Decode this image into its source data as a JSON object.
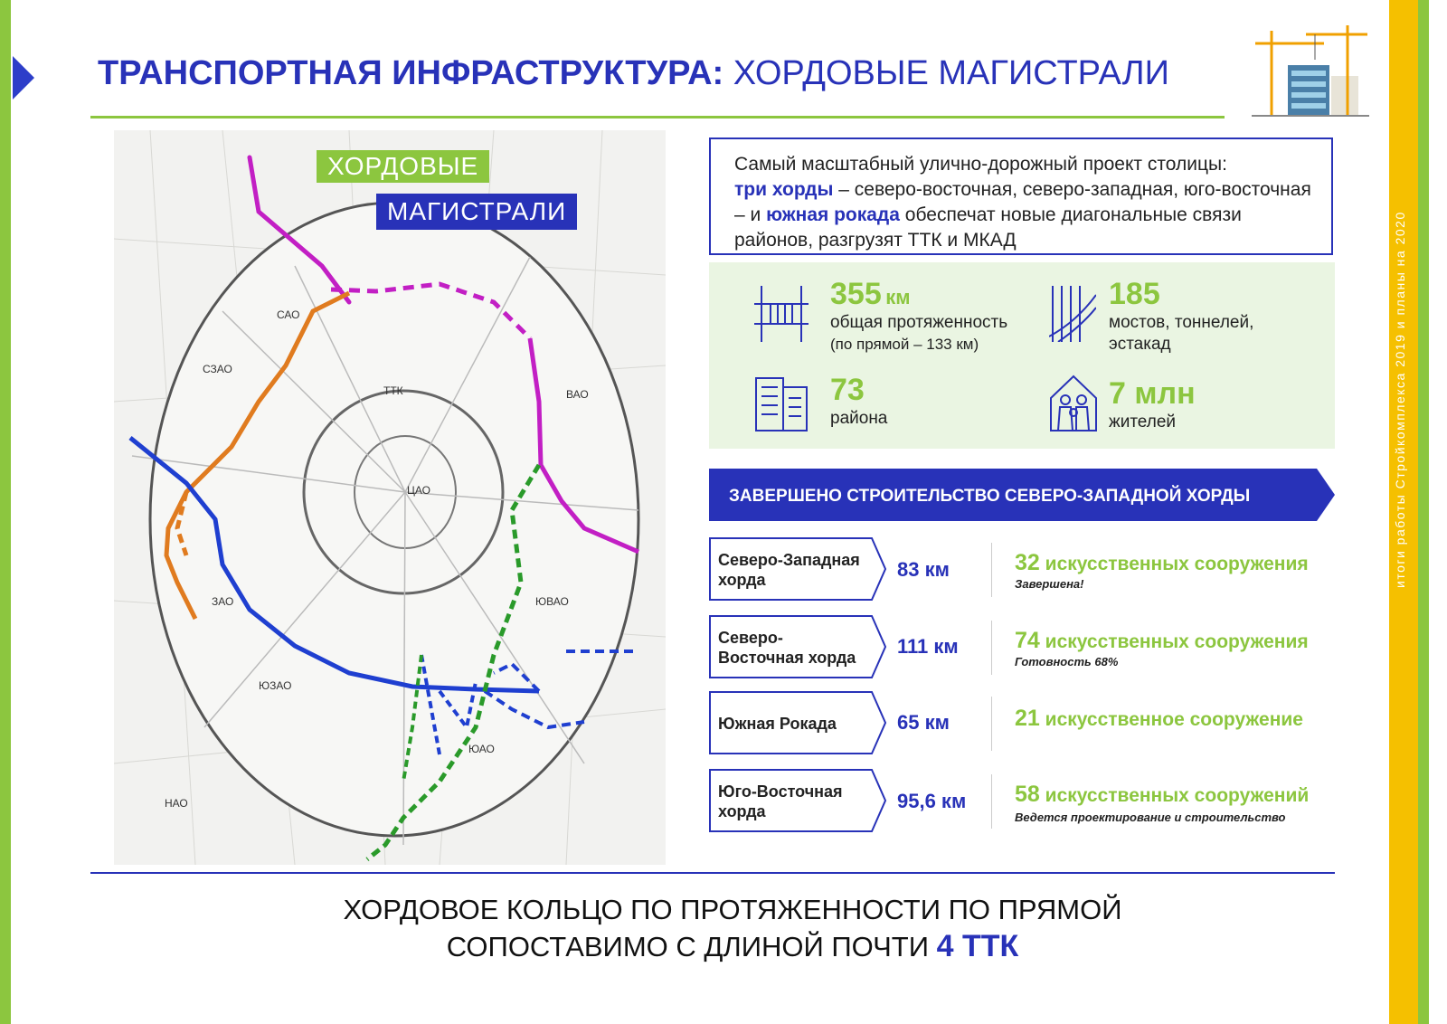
{
  "header": {
    "title_bold": "ТРАНСПОРТНАЯ ИНФРАСТРУКТУРА:",
    "title_light": "ХОРДОВЫЕ МАГИСТРАЛИ"
  },
  "side_caption": "итоги работы Стройкомплекса 2019 и планы на 2020",
  "map": {
    "label_line1": "ХОРДОВЫЕ",
    "label_line2": "МАГИСТРАЛИ",
    "districts": [
      "САО",
      "СЗАО",
      "ВАО",
      "ЦАО",
      "ЗАО",
      "ЮВАО",
      "ЮЗАО",
      "ЮАО",
      "НАО",
      "ТТК"
    ],
    "colors": {
      "nw": "#e07b1f",
      "ne": "#c21fc4",
      "south": "#1f3fd0",
      "se": "#2a9a2a"
    }
  },
  "intro": {
    "p1": "Самый масштабный улично-дорожный проект столицы:",
    "hl1": "три хорды",
    "p2": " – северо-восточная, северо-западная, юго-восточная – и ",
    "hl2": "южная рокада",
    "p3": " обеспечат новые диагональные связи районов, разгрузят ТТК и МКАД"
  },
  "stats": {
    "length": {
      "value": "355",
      "unit": "км",
      "label1": "общая протяженность",
      "label2": "(по прямой – 133 км)"
    },
    "bridges": {
      "value": "185",
      "label1": "мостов, тоннелей,",
      "label2": "эстакад"
    },
    "districts": {
      "value": "73",
      "label1": "района"
    },
    "residents": {
      "value": "7 млн",
      "label1": "жителей"
    }
  },
  "banner": "ЗАВЕРШЕНО СТРОИТЕЛЬСТВО СЕВЕРО-ЗАПАДНОЙ ХОРДЫ",
  "rows": [
    {
      "name1": "Северо-Западная",
      "name2": "хорда",
      "km": "83 км",
      "count": "32",
      "struct": "искусственных сооружения",
      "note": "Завершена!"
    },
    {
      "name1": "Северо-",
      "name2": "Восточная хорда",
      "km": "111 км",
      "count": "74",
      "struct": "искусственных сооружения",
      "note": "Готовность 68%"
    },
    {
      "name1": "Южная Рокада",
      "name2": "",
      "km": "65 км",
      "count": "21",
      "struct": "искусственное сооружение",
      "note": ""
    },
    {
      "name1": "Юго-Восточная",
      "name2": "хорда",
      "km": "95,6 км",
      "count": "58",
      "struct": "искусственных сооружений",
      "note": "Ведется проектирование и строительство"
    }
  ],
  "footer": {
    "line1": "ХОРДОВОЕ КОЛЬЦО ПО ПРОТЯЖЕННОСТИ ПО ПРЯМОЙ",
    "line2": "СОПОСТАВИМО С ДЛИНОЙ ПОЧТИ",
    "big": "4 ТТК"
  }
}
